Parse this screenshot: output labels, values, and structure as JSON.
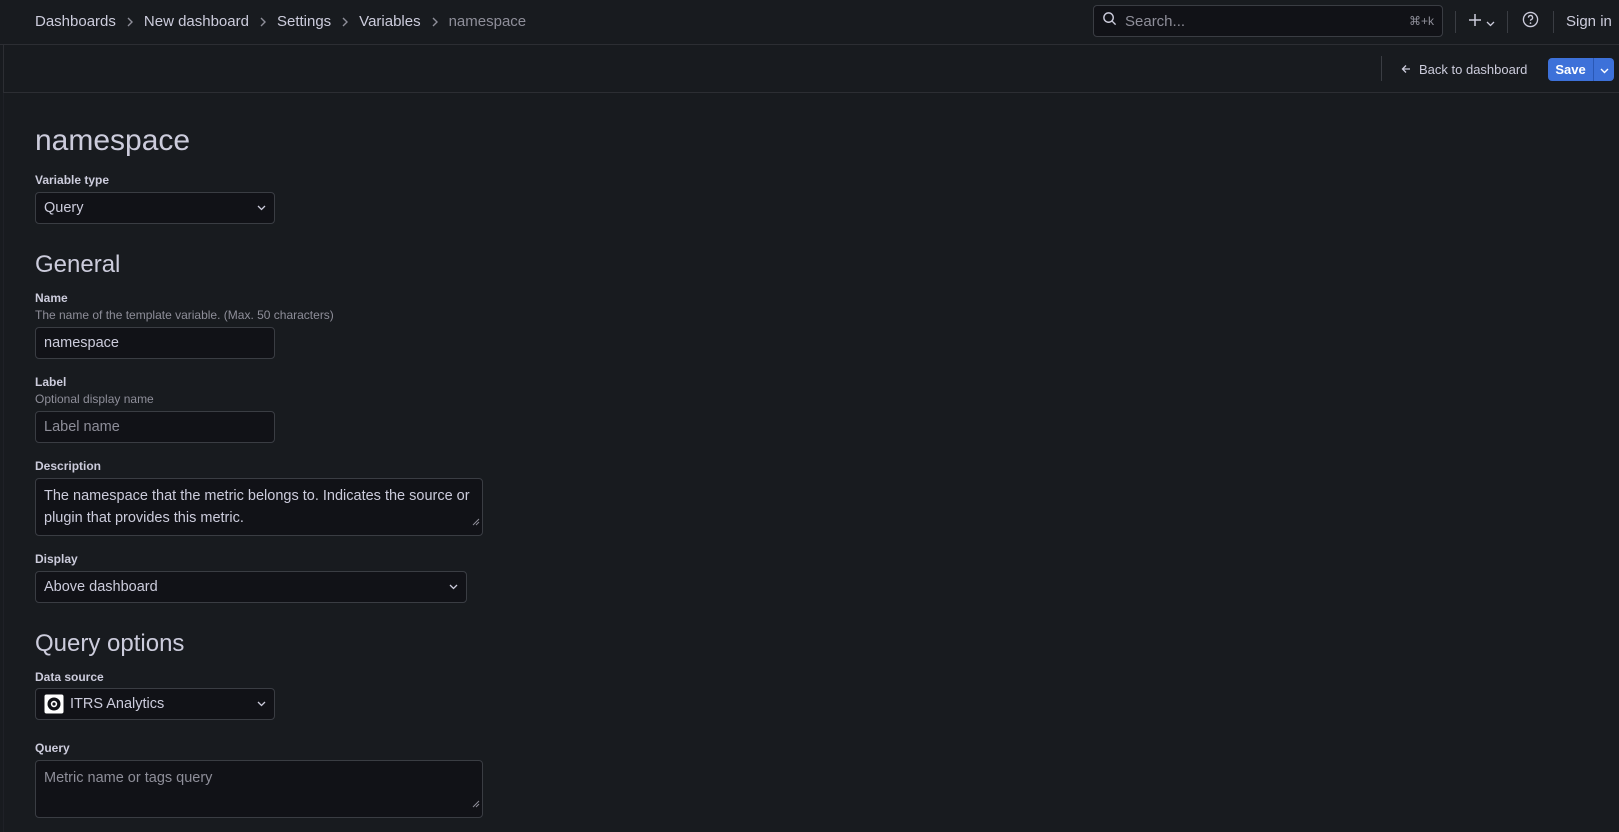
{
  "breadcrumb": {
    "items": [
      "Dashboards",
      "New dashboard",
      "Settings",
      "Variables"
    ],
    "current": "namespace"
  },
  "topbar": {
    "search_placeholder": "Search...",
    "search_shortcut": "⌘+k",
    "plus_label": "+",
    "signin_label": "Sign in"
  },
  "toolbar": {
    "back_label": "Back to dashboard",
    "save_label": "Save"
  },
  "page": {
    "title": "namespace"
  },
  "variable_type": {
    "label": "Variable type",
    "value": "Query"
  },
  "general": {
    "heading": "General",
    "name": {
      "label": "Name",
      "description": "The name of the template variable. (Max. 50 characters)",
      "value": "namespace"
    },
    "label_field": {
      "label": "Label",
      "description": "Optional display name",
      "placeholder": "Label name"
    },
    "description": {
      "label": "Description",
      "value": "The namespace that the metric belongs to. Indicates the source or plugin that provides this metric."
    },
    "display": {
      "label": "Display",
      "value": "Above dashboard"
    }
  },
  "query_options": {
    "heading": "Query options",
    "data_source": {
      "label": "Data source",
      "value": "ITRS Analytics"
    },
    "query": {
      "label": "Query",
      "placeholder": "Metric name or tags query"
    }
  },
  "colors": {
    "background": "#181b1f",
    "primary": "#3d71d9",
    "text": "#ccccdc",
    "muted": "#8e8e99",
    "border": "#3a3d43"
  }
}
